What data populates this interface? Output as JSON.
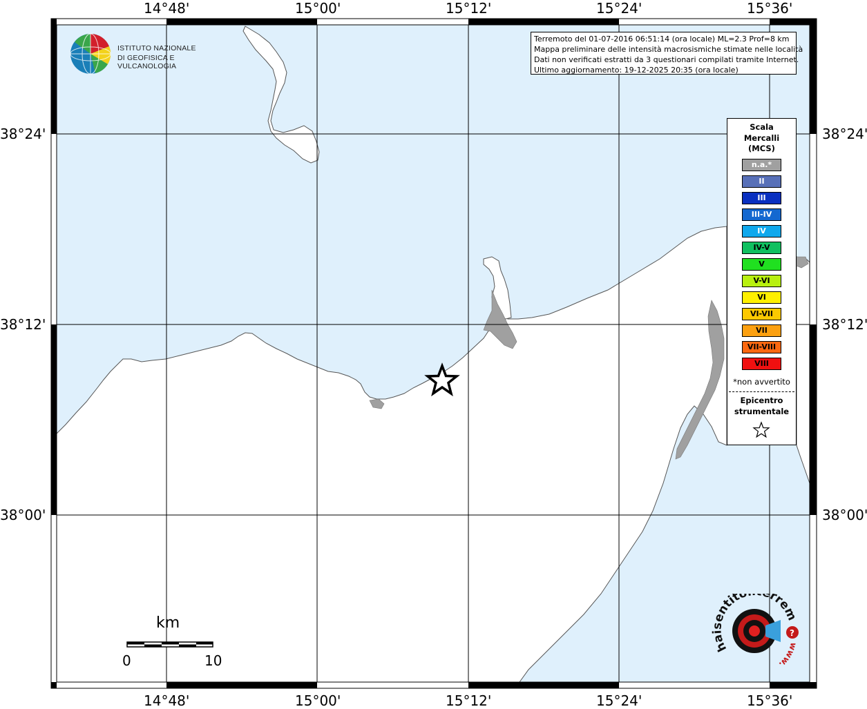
{
  "map": {
    "top_labels": [
      "14°48'",
      "15°00'",
      "15°12'",
      "15°24'",
      "15°36'"
    ],
    "bottom_labels": [
      "14°48'",
      "15°00'",
      "15°12'",
      "15°24'",
      "15°36'"
    ],
    "left_labels": [
      "38°24'",
      "38°12'",
      "38°00'"
    ],
    "right_labels": [
      "38°24'",
      "38°12'",
      "38°00'"
    ],
    "colors": {
      "sea": "#dff0fc",
      "land": "#ffffff",
      "lagoon": "#a0a0a0",
      "grid": "#000000"
    }
  },
  "info": {
    "line1": "Terremoto del 01-07-2016 06:51:14 (ora locale) ML=2.3 Prof=8 km",
    "line2": "Mappa preliminare delle intensità macrosismiche stimate nelle località",
    "line3": "Dati non verificati estratti da 3 questionari compilati tramite Internet.",
    "line4": "Ultimo aggiornamento: 19-12-2025 20:35 (ora locale)"
  },
  "legend": {
    "title1": "Scala",
    "title2": "Mercalli",
    "title3": "(MCS)",
    "items": [
      {
        "label": "n.a.*",
        "color": "#a0a0a0",
        "text": "#ffffff"
      },
      {
        "label": "II",
        "color": "#5870b8",
        "text": "#ffffff"
      },
      {
        "label": "III",
        "color": "#0a30c0",
        "text": "#ffffff"
      },
      {
        "label": "III-IV",
        "color": "#1468d0",
        "text": "#ffffff"
      },
      {
        "label": "IV",
        "color": "#10a8ec",
        "text": "#ffffff"
      },
      {
        "label": "IV-V",
        "color": "#10c060",
        "text": "#000000"
      },
      {
        "label": "V",
        "color": "#20e020",
        "text": "#000000"
      },
      {
        "label": "V-VI",
        "color": "#b8f010",
        "text": "#000000"
      },
      {
        "label": "VI",
        "color": "#fff000",
        "text": "#000000"
      },
      {
        "label": "VI-VII",
        "color": "#fcc800",
        "text": "#000000"
      },
      {
        "label": "VII",
        "color": "#fca010",
        "text": "#000000"
      },
      {
        "label": "VII-VIII",
        "color": "#fc6810",
        "text": "#000000"
      },
      {
        "label": "VIII",
        "color": "#f01010",
        "text": "#000000"
      }
    ],
    "note": "*non avvertito",
    "epicenter1": "Epicentro",
    "epicenter2": "strumentale"
  },
  "logo": {
    "line1": "ISTITUTO NAZIONALE",
    "line2": "DI GEOFISICA E VULCANOLOGIA"
  },
  "scale": {
    "unit": "km",
    "min": "0",
    "max": "10"
  },
  "brand": {
    "text": "haisentitoilterremoto.it",
    "www": "www."
  }
}
